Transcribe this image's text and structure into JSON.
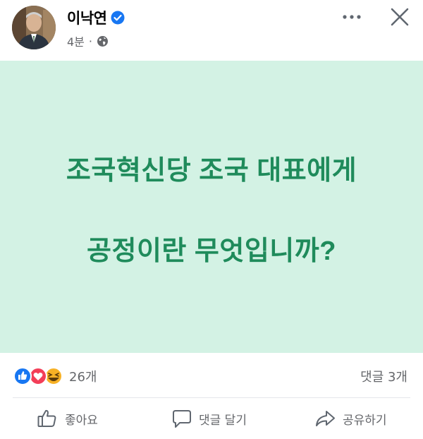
{
  "post": {
    "author_name": "이낙연",
    "time": "4분",
    "separator": "·",
    "lines": [
      "조국혁신당 조국 대표에게",
      "공정이란 무엇입니까?"
    ],
    "background_color": "#d3f2e4",
    "text_color": "#1f8b5b"
  },
  "reactions": {
    "count": "26개",
    "types": [
      "like-icon",
      "love-icon",
      "haha-icon"
    ]
  },
  "comments": {
    "count": "댓글 3개"
  },
  "actions": {
    "like": "좋아요",
    "comment": "댓글 달기",
    "share": "공유하기"
  },
  "icons": {
    "verified": "verified-badge-icon",
    "audience": "globe-icon",
    "more": "more-options-icon",
    "close": "close-icon"
  }
}
